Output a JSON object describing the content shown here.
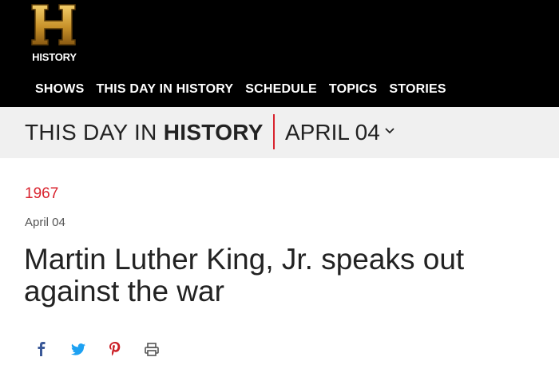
{
  "header": {
    "logo_text": "HISTORY",
    "nav": [
      "SHOWS",
      "THIS DAY IN HISTORY",
      "SCHEDULE",
      "TOPICS",
      "STORIES"
    ]
  },
  "subheader": {
    "prefix": "THIS DAY IN",
    "bold": "HISTORY",
    "selected_date": "APRIL 04"
  },
  "article": {
    "year": "1967",
    "date": "April 04",
    "title": "Martin Luther King, Jr. speaks out against the war"
  },
  "share": [
    "facebook-icon",
    "twitter-icon",
    "pinterest-icon",
    "print-icon"
  ],
  "colors": {
    "accent": "#d9232e",
    "facebook": "#3b5998",
    "twitter": "#1da1f2",
    "pinterest": "#cb2027",
    "print": "#555555",
    "logo_gold": "#c8922a"
  }
}
